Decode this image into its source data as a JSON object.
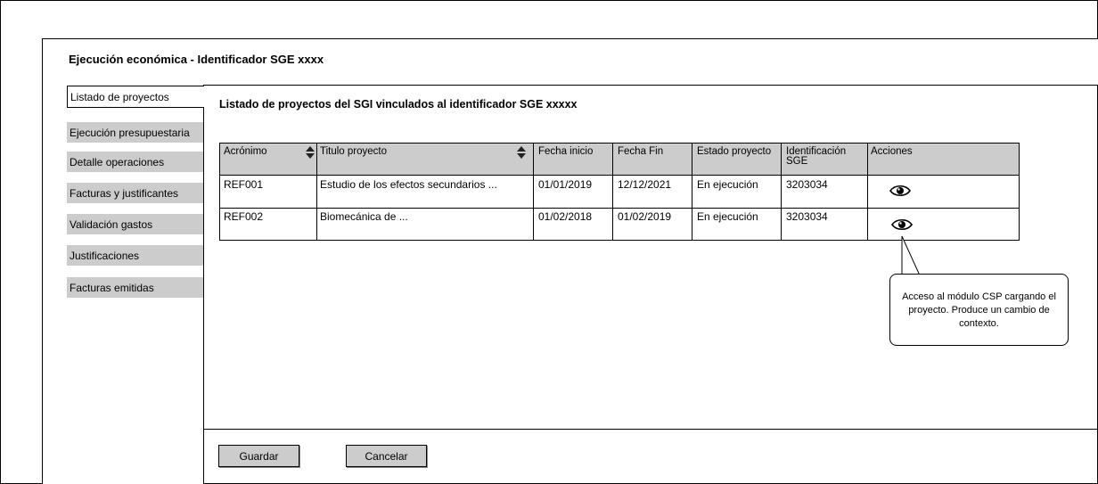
{
  "page": {
    "title": "Ejecución económica - Identificador SGE xxxx"
  },
  "tabs": [
    {
      "label": "Listado de proyectos",
      "active": true
    },
    {
      "label": "Ejecución presupuestaria"
    },
    {
      "label": "Detalle operaciones"
    },
    {
      "label": "Facturas y justificantes"
    },
    {
      "label": "Validación gastos"
    },
    {
      "label": "Justificaciones"
    },
    {
      "label": "Facturas emitidas"
    }
  ],
  "panel": {
    "title": "Listado de proyectos del SGI vinculados al  identificador SGE xxxxx"
  },
  "table": {
    "headers": [
      "Acrónimo",
      "Titulo proyecto",
      "Fecha inicio",
      "Fecha Fin",
      "Estado proyecto",
      "Identificación SGE",
      "Acciones"
    ],
    "rows": [
      [
        "REF001",
        "Estudio de los efectos secundarios ...",
        "01/01/2019",
        "12/12/2021",
        "En ejecución",
        "3203034"
      ],
      [
        "REF002",
        "Biomecánica de ...",
        "01/02/2018",
        "01/02/2019",
        "En ejecución",
        "3203034"
      ]
    ],
    "sortable_columns": [
      "Acrónimo",
      "Titulo proyecto"
    ],
    "row_action_icon": "eye-icon"
  },
  "callout": {
    "text": "Acceso al módulo CSP cargando el proyecto. Produce un cambio de contexto."
  },
  "buttons": {
    "save": "Guardar",
    "cancel": "Cancelar"
  },
  "colors": {
    "tab_bg": "#cccccc",
    "header_bg": "#cccccc",
    "button_bg": "#cccccc"
  }
}
